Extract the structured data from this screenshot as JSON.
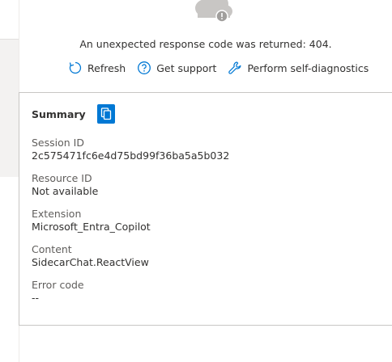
{
  "error": {
    "message": "An unexpected response code was returned: 404."
  },
  "actions": {
    "refresh": "Refresh",
    "support": "Get support",
    "diagnostics": "Perform self-diagnostics"
  },
  "summary": {
    "title": "Summary",
    "fields": [
      {
        "label": "Session ID",
        "value": "2c575471fc6e4d75bd99f36ba5a5b032"
      },
      {
        "label": "Resource ID",
        "value": "Not available"
      },
      {
        "label": "Extension",
        "value": "Microsoft_Entra_Copilot"
      },
      {
        "label": "Content",
        "value": "SidecarChat.ReactView"
      },
      {
        "label": "Error code",
        "value": "--"
      }
    ]
  },
  "colors": {
    "accent": "#0078d4",
    "icon_blue": "#0078d4",
    "cloud_grey": "#c8c6c4"
  },
  "icons": {
    "cloud": "cloud-error-icon",
    "refresh": "refresh-icon",
    "support": "help-circle-icon",
    "diagnostics": "wrench-icon",
    "copy": "copy-icon"
  }
}
